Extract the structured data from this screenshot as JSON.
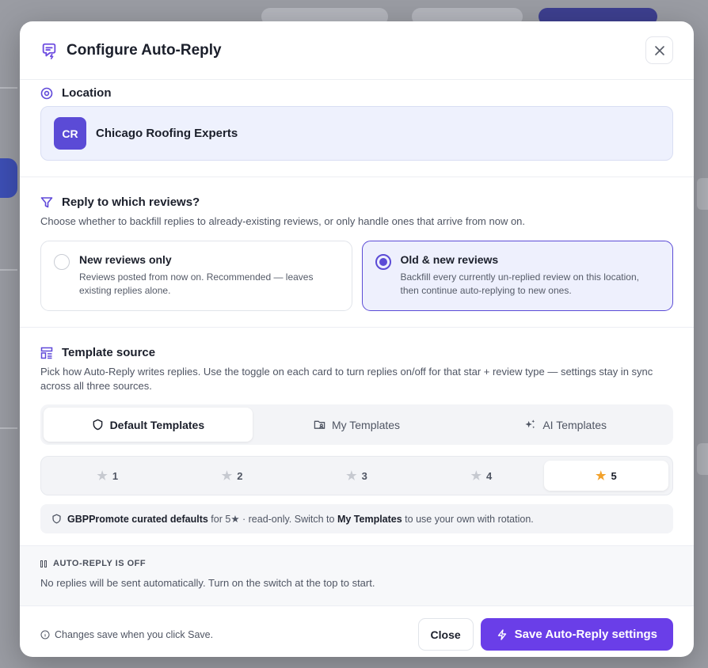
{
  "dialog": {
    "title": "Configure Auto-Reply",
    "close_icon": "close-icon"
  },
  "location": {
    "label": "Location",
    "avatar_initials": "CR",
    "name": "Chicago Roofing Experts"
  },
  "reply_scope": {
    "label": "Reply to which reviews?",
    "description": "Choose whether to backfill replies to already-existing reviews, or only handle ones that arrive from now on.",
    "options": [
      {
        "title": "New reviews only",
        "description": "Reviews posted from now on. Recommended — leaves existing replies alone.",
        "selected": false
      },
      {
        "title": "Old & new reviews",
        "description": "Backfill every currently un-replied review on this location, then continue auto-replying to new ones.",
        "selected": true
      }
    ]
  },
  "template_source": {
    "label": "Template source",
    "description": "Pick how Auto-Reply writes replies. Use the toggle on each card to turn replies on/off for that star + review type — settings stay in sync across all three sources.",
    "tabs": [
      {
        "label": "Default Templates",
        "icon": "shield-icon",
        "active": true
      },
      {
        "label": "My Templates",
        "icon": "folder-user-icon",
        "active": false
      },
      {
        "label": "AI Templates",
        "icon": "sparkle-icon",
        "active": false
      }
    ],
    "star_tabs": [
      {
        "label": "1",
        "active": false
      },
      {
        "label": "2",
        "active": false
      },
      {
        "label": "3",
        "active": false
      },
      {
        "label": "4",
        "active": false
      },
      {
        "label": "5",
        "active": true
      }
    ],
    "note": {
      "bold_lead": "GBPPromote curated defaults",
      "middle": " for 5★ · read-only. Switch to ",
      "bold_link": "My Templates",
      "tail": " to use your own with rotation."
    }
  },
  "status": {
    "label": "AUTO-REPLY IS OFF",
    "text": "No replies will be sent automatically. Turn on the switch at the top to start."
  },
  "footer": {
    "note": "Changes save when you click Save.",
    "close_label": "Close",
    "save_label": "Save Auto-Reply settings"
  },
  "colors": {
    "accent": "#6a3ee8",
    "selected_border": "#5b4bd6",
    "star_active": "#f2a12b"
  }
}
